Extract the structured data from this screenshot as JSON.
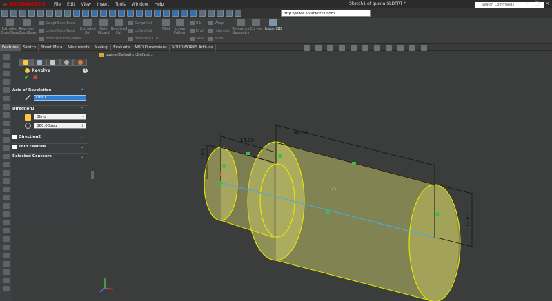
{
  "app": {
    "brand": "SOLIDWORKS",
    "document_title": "Sketch1 of quena.SLDPRT *",
    "menus": [
      "File",
      "Edit",
      "View",
      "Insert",
      "Tools",
      "Window",
      "Help"
    ],
    "search_placeholder": "Search Commands",
    "url": "http://www.solidworks.com"
  },
  "command_manager": {
    "big_buttons": [
      "Extruded Boss/Base",
      "Revolved Boss/Base",
      "Extruded Cut",
      "Hole Wizard",
      "Revolved Cut",
      "Fillet",
      "Linear Pattern",
      "Reference Geometry",
      "Curves",
      "Instant3D"
    ],
    "small_buttons": [
      "Swept Boss/Base",
      "Lofted Boss/Base",
      "Boundary Boss/Base",
      "Swept Cut",
      "Lofted Cut",
      "Boundary Cut",
      "Rib",
      "Draft",
      "Shell",
      "Wrap",
      "Intersect",
      "Mirror"
    ]
  },
  "tabs": [
    "Features",
    "Sketch",
    "Sheet Metal",
    "Weldments",
    "Markup",
    "Evaluate",
    "MBD Dimensions",
    "SOLIDWORKS Add-Ins"
  ],
  "active_tab": "Features",
  "property_manager": {
    "title": "Revolve",
    "axis_group": "Axis of Revolution",
    "axis_value": "Line1",
    "direction1_group": "Direction1",
    "end_condition": "Blind",
    "angle": "360.00deg",
    "direction2_group": "Direction2",
    "thin_feature_group": "Thin Feature",
    "selected_contours_group": "Selected Contours"
  },
  "feature_tree_flyout": "quena (Default<<Default...",
  "dimensions": {
    "d1": "14.00",
    "d2": "40.00",
    "d3": "7.60",
    "d4": "12.60"
  },
  "colors": {
    "accent": "#2e7fd6",
    "body_fill": "#c8c86a",
    "edge": "#e6e600",
    "axis_line": "#4aa8e6",
    "sketch_line": "#000000",
    "ok": "#46c63a",
    "cancel": "#e0483a"
  }
}
